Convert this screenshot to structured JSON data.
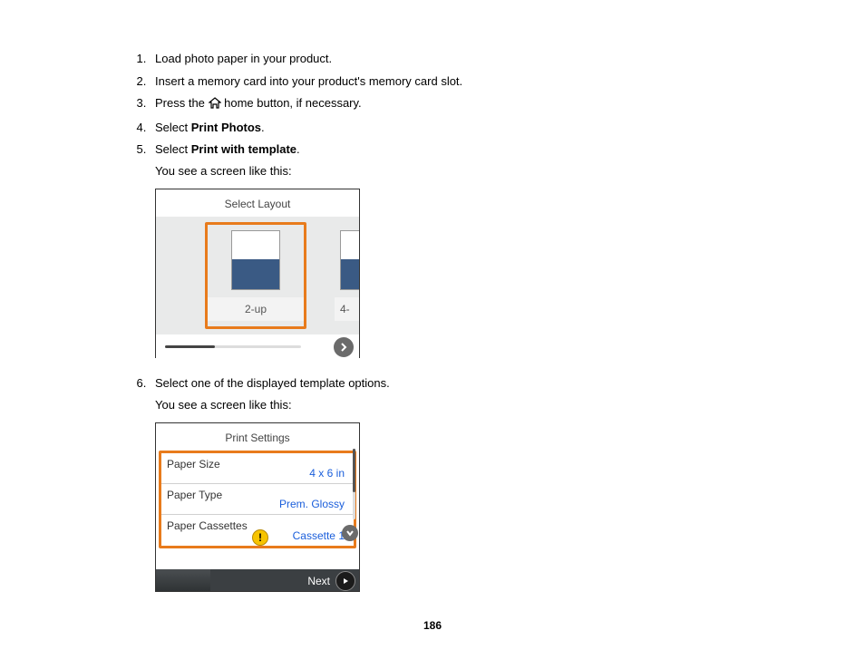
{
  "steps": {
    "s1": "Load photo paper in your product.",
    "s2": "Insert a memory card into your product's memory card slot.",
    "s3_pre": "Press the ",
    "s3_post": " home button, if necessary.",
    "s4_pre": "Select ",
    "s4_bold": "Print Photos",
    "s4_post": ".",
    "s5_pre": "Select ",
    "s5_bold": "Print with template",
    "s5_post": ".",
    "s5_sub": "You see a screen like this:",
    "s6": "Select one of the displayed template options.",
    "s6_sub": "You see a screen like this:"
  },
  "shot1": {
    "title": "Select Layout",
    "option1": "2-up",
    "option2_partial": "4-"
  },
  "shot2": {
    "title": "Print Settings",
    "rows": {
      "r1_label": "Paper Size",
      "r1_value": "4 x 6 in",
      "r2_label": "Paper Type",
      "r2_value": "Prem. Glossy",
      "r3_label": "Paper Cassettes",
      "r3_value": "Cassette 1"
    },
    "warn": "!",
    "next": "Next"
  },
  "page_number": "186"
}
